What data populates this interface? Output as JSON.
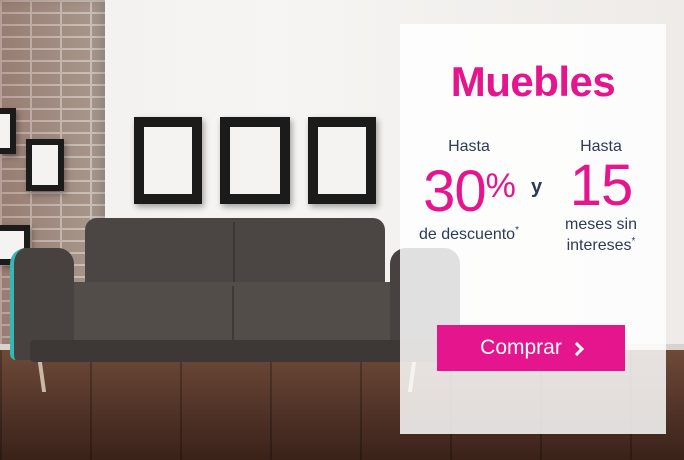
{
  "promo": {
    "title": "Muebles",
    "discount": {
      "prefix": "Hasta",
      "value": "30",
      "unit": "%",
      "label": "de descuento",
      "asterisk": "*"
    },
    "connector": "y",
    "installments": {
      "prefix": "Hasta",
      "value": "15",
      "label_line1": "meses sin",
      "label_line2": "intereses",
      "asterisk": "*"
    },
    "cta_label": "Comprar"
  },
  "colors": {
    "accent": "#e5158d",
    "text": "#2e3b55",
    "panel": "#ffffff"
  },
  "icons": {
    "cta": "chevron-right-icon"
  }
}
